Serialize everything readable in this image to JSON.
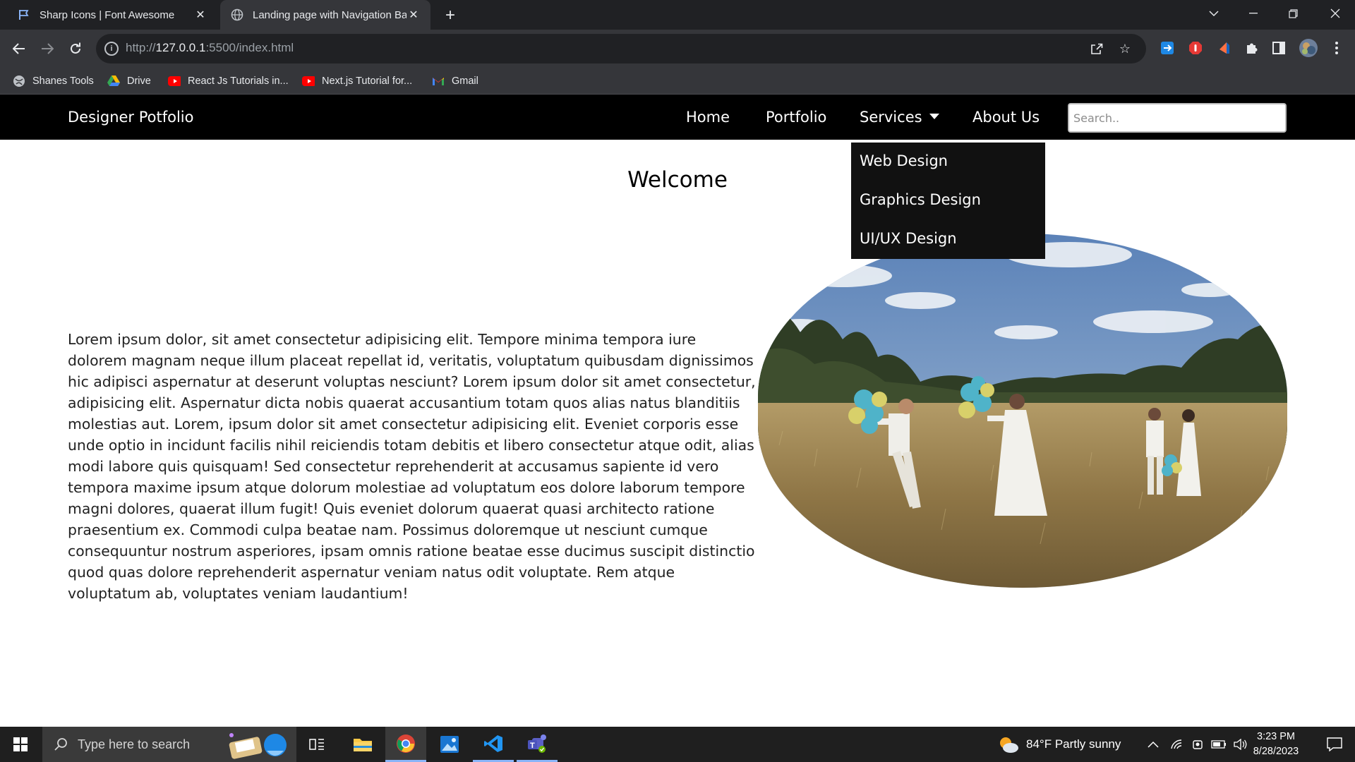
{
  "browser": {
    "tabs": [
      {
        "title": "Sharp Icons | Font Awesome",
        "active": false
      },
      {
        "title": "Landing page with Navigation Ba",
        "active": true
      }
    ],
    "url_host": "127.0.0.1",
    "url_prefix": "http://",
    "url_suffix": ":5500/index.html",
    "bookmarks": [
      "Shanes Tools",
      "Drive",
      "React Js Tutorials in...",
      "Next.js Tutorial for...",
      "Gmail"
    ],
    "icons": [
      "back-icon",
      "forward-icon",
      "reload-icon",
      "share-icon",
      "bookmark-star-icon",
      "extensions-icon",
      "side-panel-icon",
      "profile-avatar",
      "menu-icon"
    ]
  },
  "site": {
    "brand": "Designer Potfolio",
    "nav": {
      "home": "Home",
      "portfolio": "Portfolio",
      "services": "Services",
      "about": "About Us"
    },
    "search_placeholder": "Search..",
    "dropdown": [
      "Web Design",
      "Graphics Design",
      "UI/UX Design"
    ],
    "welcome": "Welcome",
    "paragraph": "Lorem ipsum dolor, sit amet consectetur adipisicing elit. Tempore minima tempora iure dolorem magnam neque illum placeat repellat id, veritatis, voluptatum quibusdam dignissimos hic adipisci aspernatur at deserunt voluptas nesciunt? Lorem ipsum dolor sit amet consectetur, adipisicing elit. Aspernatur dicta nobis quaerat accusantium totam quos alias natus blanditiis molestias aut. Lorem, ipsum dolor sit amet consectetur adipisicing elit. Eveniet corporis esse unde optio in incidunt facilis nihil reiciendis totam debitis et libero consectetur atque odit, alias modi labore quis quisquam! Sed consectetur reprehenderit at accusamus sapiente id vero tempora maxime ipsum atque dolorum molestiae ad voluptatum eos dolore laborum tempore magni dolores, quaerat illum fugit! Quis eveniet dolorum quaerat quasi architecto ratione praesentium ex. Commodi culpa beatae nam. Possimus doloremque ut nesciunt cumque consequuntur nostrum asperiores, ipsam omnis ratione beatae esse ducimus suscipit distinctio quod quas dolore reprehenderit aspernatur veniam natus odit voluptate. Rem atque voluptatum ab, voluptates veniam laudantium!",
    "hero_image": "photo-couples-with-balloons-in-field"
  },
  "taskbar": {
    "search_placeholder": "Type here to search",
    "weather": "84°F  Partly sunny",
    "time": "3:23 PM",
    "date": "8/28/2023"
  },
  "colors": {
    "nav_bg": "#000000",
    "dropdown_bg": "#111111",
    "chrome_bg": "#202124",
    "toolbar_bg": "#35363a"
  }
}
